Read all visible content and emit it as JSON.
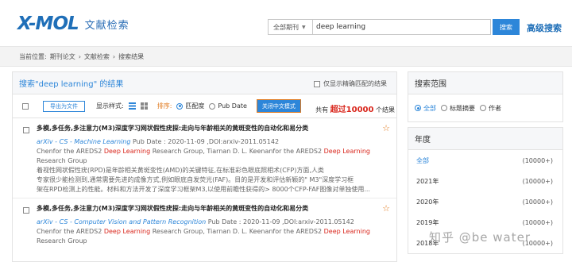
{
  "header": {
    "logo_text": "X-MOL",
    "logo_subtitle": "文献检索",
    "scope_value": "全部期刊",
    "search_value": "deep learning",
    "search_button": "搜索",
    "advanced_link": "高级搜索"
  },
  "breadcrumb": {
    "label": "当前位置:",
    "items": [
      "期刊论文",
      "文献检索",
      "搜索结果"
    ],
    "separator": "›"
  },
  "results": {
    "heading": "搜索\"deep learning\" 的结果",
    "exact_match_label": "仅显示精确匹配的结果",
    "export_button": "导出为文件",
    "display_style_label": "显示样式:",
    "sort_label": "排序:",
    "sort_relevance": "匹配度",
    "sort_pubdate": "Pub Date",
    "cn_mode_button": "关闭中文模式",
    "total_prefix": "共有",
    "total_count": "超过10000",
    "total_suffix": "个结果",
    "items": [
      {
        "title": "多模,多任务,多注意力(M3)深度学习网状假性疣探:走向与年龄相关的黄斑变性的自动化和易分类",
        "source": "arXiv - CS - Machine Learning",
        "meta": "Pub Date : 2020-11-09 ,DOI:arxiv-2011.05142",
        "authors_pre": "Chenfor the AREDS2 ",
        "authors_hl": "Deep Learning",
        "authors_mid": " Research Group, Tiarnan D. L. Keenanfor the AREDS2 ",
        "authors_hl2": "Deep Learning",
        "authors_post": " Research Group",
        "abstract_1": "着视性网状假性疣(RPD)是年龄相关黄斑变性(AMD)的关键特征,在标准彩色眼底照相术(CFP)方面,人类",
        "abstract_2": "专家很少能检测到,通常需要先进的成像方式,例如眼底自发荧光(FAF)。目的是开发和评估新颖的\" M3\"深度学习框",
        "abstract_3": "架在RPD检测上的性能。材料和方法开发了深度学习框架M3,以使用前瞻性获得的> 8000个CFP-FAF图像对单独使用..."
      },
      {
        "title": "多模,多任务,多注意力(M3)深度学习网状假性疣探:走向与年龄相关的黄斑变性的自动化和易分类",
        "source": "arXiv - CS - Computer Vision and Pattern Recognition",
        "meta": "Pub Date : 2020-11-09 ,DOI:arxiv-2011.05142",
        "authors_pre": "Chenfor the AREDS2 ",
        "authors_hl": "Deep Learning",
        "authors_mid": " Research Group, Tiarnan D. L. Keenanfor the AREDS2 ",
        "authors_hl2": "Deep Learning",
        "authors_post": " Research Group"
      }
    ]
  },
  "sidebar": {
    "scope_heading": "搜索范围",
    "scope_options": [
      "全部",
      "标题摘要",
      "作者"
    ],
    "year_heading": "年度",
    "years": [
      {
        "label": "全部",
        "count": "(10000+)"
      },
      {
        "label": "2021年",
        "count": "(10000+)"
      },
      {
        "label": "2020年",
        "count": "(10000+)"
      },
      {
        "label": "2019年",
        "count": "(10000+)"
      },
      {
        "label": "2018年",
        "count": "(10000+)"
      }
    ]
  },
  "watermark": "知乎 @be water",
  "colors": {
    "accent": "#2d86d9",
    "highlight": "#d9261c",
    "sort_orange": "#e07a1f"
  }
}
